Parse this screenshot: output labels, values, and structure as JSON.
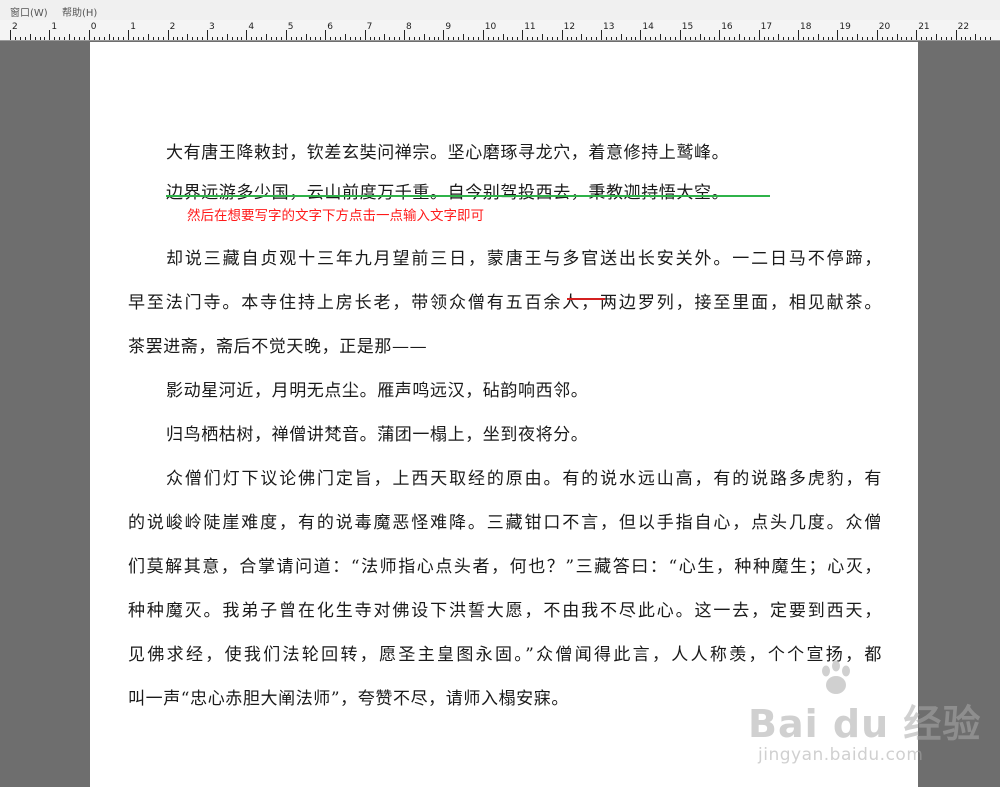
{
  "menu": {
    "window": "窗口(W)",
    "help": "帮助(H)"
  },
  "ruler": {
    "labels": [
      "2",
      "1",
      "0",
      "1",
      "2",
      "3",
      "4",
      "5",
      "6",
      "7",
      "8",
      "9",
      "10",
      "11",
      "12",
      "13",
      "14",
      "15",
      "16",
      "17",
      "18",
      "19",
      "20",
      "21",
      "22"
    ]
  },
  "document": {
    "poem_line_1": "大有唐王降敕封，钦差玄奘问禅宗。坚心磨琢寻龙穴，着意修持上鹫峰。",
    "poem_line_2": "边界远游多少国，云山前度万千重。自今别驾投西去，秉教迦持悟大空。",
    "annotation": "然后在想要写字的文字下方点击一点输入文字即可",
    "para1_line1": "却说三藏自贞观十三年九月望前三日，蒙唐王与多官送出长安关外。一二日马不停蹄，",
    "para1_line2": "早至法门寺。本寺住持上房长老，带领众僧有五百余人，两边罗列，接至里面，相见献茶。",
    "para1_line3": "茶罢进斋，斋后不觉天晚，正是那——",
    "verse_line_1": "影动星河近，月明无点尘。雁声鸣远汉，砧韵响西邻。",
    "verse_line_2": "归鸟栖枯树，禅僧讲梵音。蒲团一榻上，坐到夜将分。",
    "para2_line1": "众僧们灯下议论佛门定旨，上西天取经的原由。有的说水远山高，有的说路多虎豹，有",
    "para2_line2": "的说峻岭陡崖难度，有的说毒魔恶怪难降。三藏钳口不言，但以手指自心，点头几度。众僧",
    "para2_line3": "们莫解其意，合掌请问道：“法师指心点头者，何也？”三藏答曰：“心生，种种魔生；心灭，",
    "para2_line4": "种种魔灭。我弟子曾在化生寺对佛设下洪誓大愿，不由我不尽此心。这一去，定要到西天，",
    "para2_line5": "见佛求经，使我们法轮回转，愿圣主皇图永固。”众僧闻得此言，人人称羡，个个宣扬，都",
    "para2_line6": "叫一声“忠心赤胆大阐法师”，夸赞不尽，请师入榻安寐。"
  },
  "watermark": {
    "brand": "Bai du 经验",
    "url": "jingyan.baidu.com"
  },
  "colors": {
    "annotation": "#ff1a1a",
    "underline": "#2fb34a",
    "strike": "#d42020",
    "background": "#6e6e6e"
  }
}
